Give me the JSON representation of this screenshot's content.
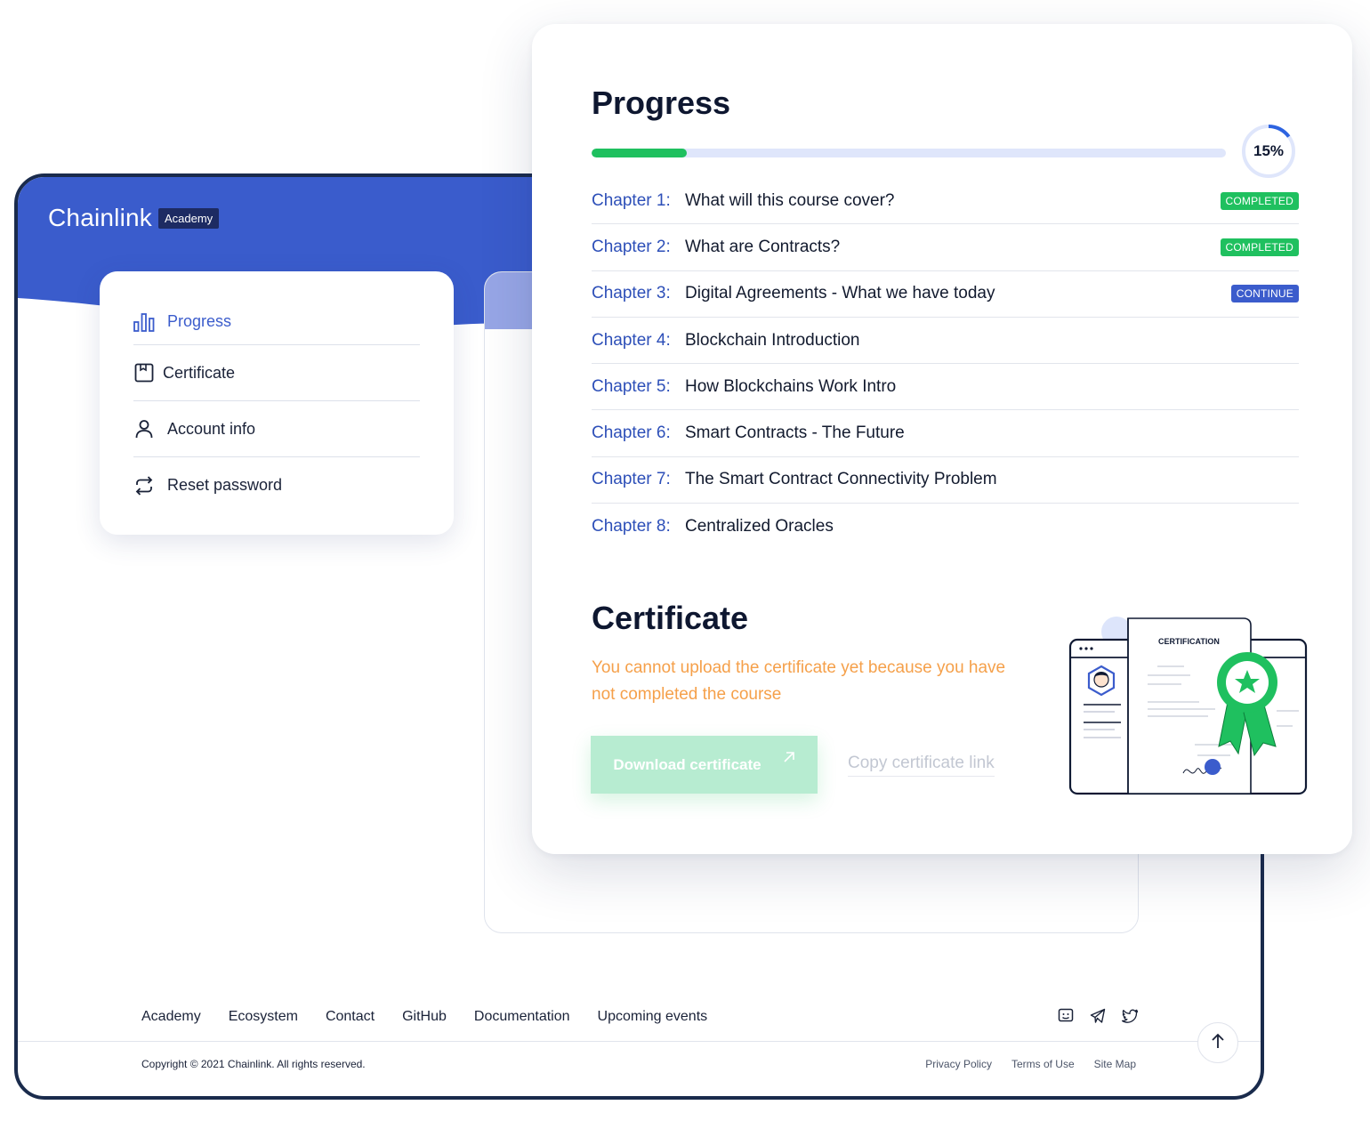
{
  "brand": {
    "name": "Chainlink",
    "badge": "Academy"
  },
  "colors": {
    "primary": "#3b5ccc",
    "success": "#1fc05f",
    "warning": "#f5a04a",
    "navy": "#1a2b4c"
  },
  "sidebar": {
    "items": [
      {
        "label": "Progress",
        "icon": "bar-chart-icon",
        "active": true
      },
      {
        "label": "Certificate",
        "icon": "certificate-icon",
        "active": false
      },
      {
        "label": "Account info",
        "icon": "user-icon",
        "active": false
      },
      {
        "label": "Reset password",
        "icon": "refresh-icon",
        "active": false
      }
    ]
  },
  "progress": {
    "title": "Progress",
    "percent": 15,
    "percent_label": "15%",
    "chapters": [
      {
        "num": "Chapter 1:",
        "title": "What will this course cover?",
        "status": "COMPLETED"
      },
      {
        "num": "Chapter 2:",
        "title": "What are Contracts?",
        "status": "COMPLETED"
      },
      {
        "num": "Chapter 3:",
        "title": "Digital Agreements - What we have today",
        "status": "CONTINUE"
      },
      {
        "num": "Chapter 4:",
        "title": "Blockchain Introduction",
        "status": ""
      },
      {
        "num": "Chapter 5:",
        "title": "How Blockchains Work Intro",
        "status": ""
      },
      {
        "num": "Chapter 6:",
        "title": "Smart Contracts - The Future",
        "status": ""
      },
      {
        "num": "Chapter 7:",
        "title": "The Smart Contract Connectivity Problem",
        "status": ""
      },
      {
        "num": "Chapter 8:",
        "title": "Centralized Oracles",
        "status": ""
      }
    ]
  },
  "certificate": {
    "title": "Certificate",
    "warning": "You cannot upload the certificate yet because you have not completed the course",
    "download_label": "Download certificate",
    "copy_label": "Copy certificate link",
    "illustration_label": "CERTIFICATION"
  },
  "footer": {
    "links": [
      "Academy",
      "Ecosystem",
      "Contact",
      "GitHub",
      "Documentation",
      "Upcoming events"
    ],
    "social": [
      "discord-icon",
      "telegram-icon",
      "twitter-icon"
    ],
    "copyright": "Copyright © 2021 Chainlink. All rights reserved.",
    "legal": [
      "Privacy Policy",
      "Terms of Use",
      "Site Map"
    ]
  }
}
